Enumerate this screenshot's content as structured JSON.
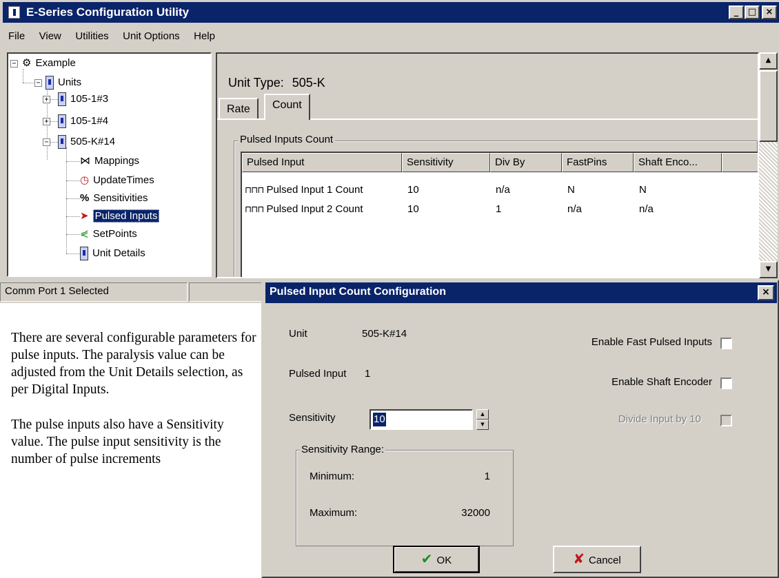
{
  "window": {
    "title": "E-Series Configuration Utility",
    "minimize": "_",
    "maximize": "□",
    "close": "×"
  },
  "menu": [
    "File",
    "View",
    "Utilities",
    "Unit Options",
    "Help"
  ],
  "tree": {
    "root": "Example",
    "units": "Units",
    "unit_a": "105-1#3",
    "unit_b": "105-1#4",
    "unit_c": "505-K#14",
    "children": [
      "Mappings",
      "UpdateTimes",
      "Sensitivities",
      "Pulsed Inputs",
      "SetPoints",
      "Unit Details"
    ]
  },
  "panel": {
    "unit_type_label": "Unit Type:",
    "unit_type_value": "505-K",
    "tabs": [
      "Rate",
      "Count"
    ],
    "group_label": "Pulsed Inputs Count",
    "columns": [
      "Pulsed Input",
      "Sensitivity",
      "Div By",
      "FastPins",
      "Shaft Enco..."
    ],
    "rows": [
      [
        "Pulsed Input 1 Count",
        "10",
        "n/a",
        "N",
        "N"
      ],
      [
        "Pulsed Input 2 Count",
        "10",
        "1",
        "n/a",
        "n/a"
      ]
    ]
  },
  "status": {
    "text": "Comm Port 1 Selected"
  },
  "doc": {
    "para1": "There are several configurable parameters for pulse inputs.  The paralysis value can be adjusted from the Unit Details selection, as per Digital Inputs.",
    "para2": "The pulse inputs also have a Sensitivity value.  The pulse input sensitivity is the number of pulse increments"
  },
  "dialog": {
    "title": "Pulsed Input Count Configuration",
    "close": "×",
    "unit_label": "Unit",
    "unit_value": "505-K#14",
    "pulsed_input_label": "Pulsed Input",
    "pulsed_input_value": "1",
    "sensitivity_label": "Sensitivity",
    "sensitivity_value": "10",
    "range_label": "Sensitivity Range:",
    "minimum_label": "Minimum:",
    "minimum_value": "1",
    "maximum_label": "Maximum:",
    "maximum_value": "32000",
    "fast_label": "Enable Fast Pulsed Inputs",
    "shaft_label": "Enable Shaft Encoder",
    "divide_label": "Divide Input by 10",
    "ok": "OK",
    "cancel": "Cancel"
  }
}
